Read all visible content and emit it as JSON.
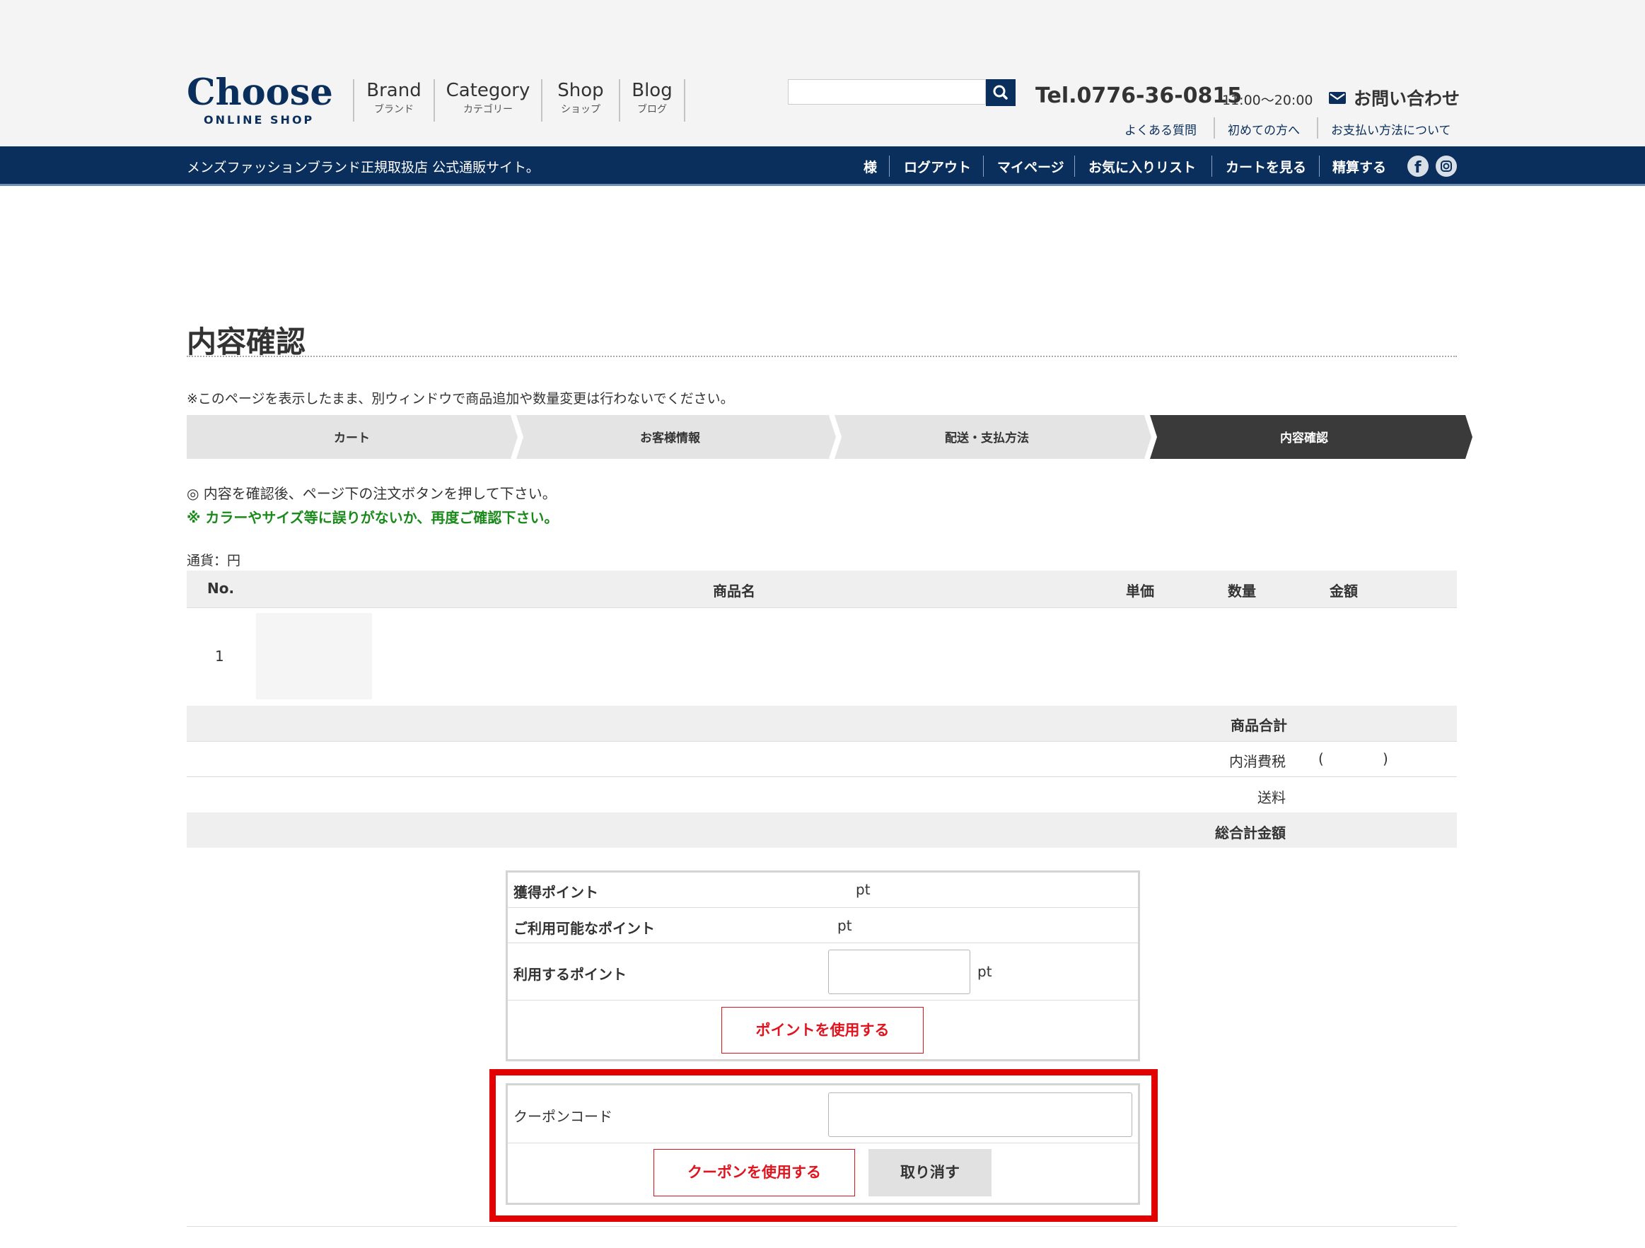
{
  "header": {
    "logo": "Choose",
    "logo_sub": "ONLINE SHOP",
    "nav": [
      {
        "en": "Brand",
        "jp": "ブランド"
      },
      {
        "en": "Category",
        "jp": "カテゴリー"
      },
      {
        "en": "Shop",
        "jp": "ショップ"
      },
      {
        "en": "Blog",
        "jp": "ブログ"
      }
    ],
    "search_value": "",
    "tel": "Tel.0776-36-0815",
    "hours": "11:00〜20:00",
    "contact": "お問い合わせ",
    "sublinks": [
      "よくある質問",
      "初めての方へ",
      "お支払い方法について"
    ]
  },
  "navbar": {
    "tagline": "メンズファッションブランド正規取扱店 公式通販サイト。",
    "links": [
      "様",
      "ログアウト",
      "マイページ",
      "お気に入りリスト",
      "カートを見る",
      "精算する"
    ]
  },
  "main": {
    "title": "内容確認",
    "notice": "※このページを表示したまま、別ウィンドウで商品追加や数量変更は行わないでください。",
    "steps": [
      "カート",
      "お客様情報",
      "配送・支払方法",
      "内容確認"
    ],
    "active_step": 3,
    "instruction1": "◎ 内容を確認後、ページ下の注文ボタンを押して下さい。",
    "instruction2": "※ カラーやサイズ等に誤りがないか、再度ご確認下さい。",
    "currency": "通貨：円",
    "table": {
      "headers": [
        "No.",
        "商品名",
        "単価",
        "数量",
        "金額"
      ],
      "rows": [
        {
          "no": "1"
        }
      ]
    },
    "summary": {
      "subtotal": "商品合計",
      "tax": "内消費税",
      "tax_open": "(",
      "tax_close": ")",
      "shipping": "送料",
      "total": "総合計金額"
    },
    "points": {
      "earned_label": "獲得ポイント",
      "earned_unit": "pt",
      "available_label": "ご利用可能なポイント",
      "available_unit": "pt",
      "use_label": "利用するポイント",
      "use_value": "",
      "use_unit": "pt",
      "use_button": "ポイントを使用する"
    },
    "coupon": {
      "label": "クーポンコード",
      "value": "",
      "use_button": "クーポンを使用する",
      "cancel_button": "取り消す"
    }
  },
  "colors": {
    "brand_navy": "#0a2f5c",
    "green_text": "#1a8a1a",
    "red_button": "#e0141e",
    "highlight": "#e20000"
  }
}
